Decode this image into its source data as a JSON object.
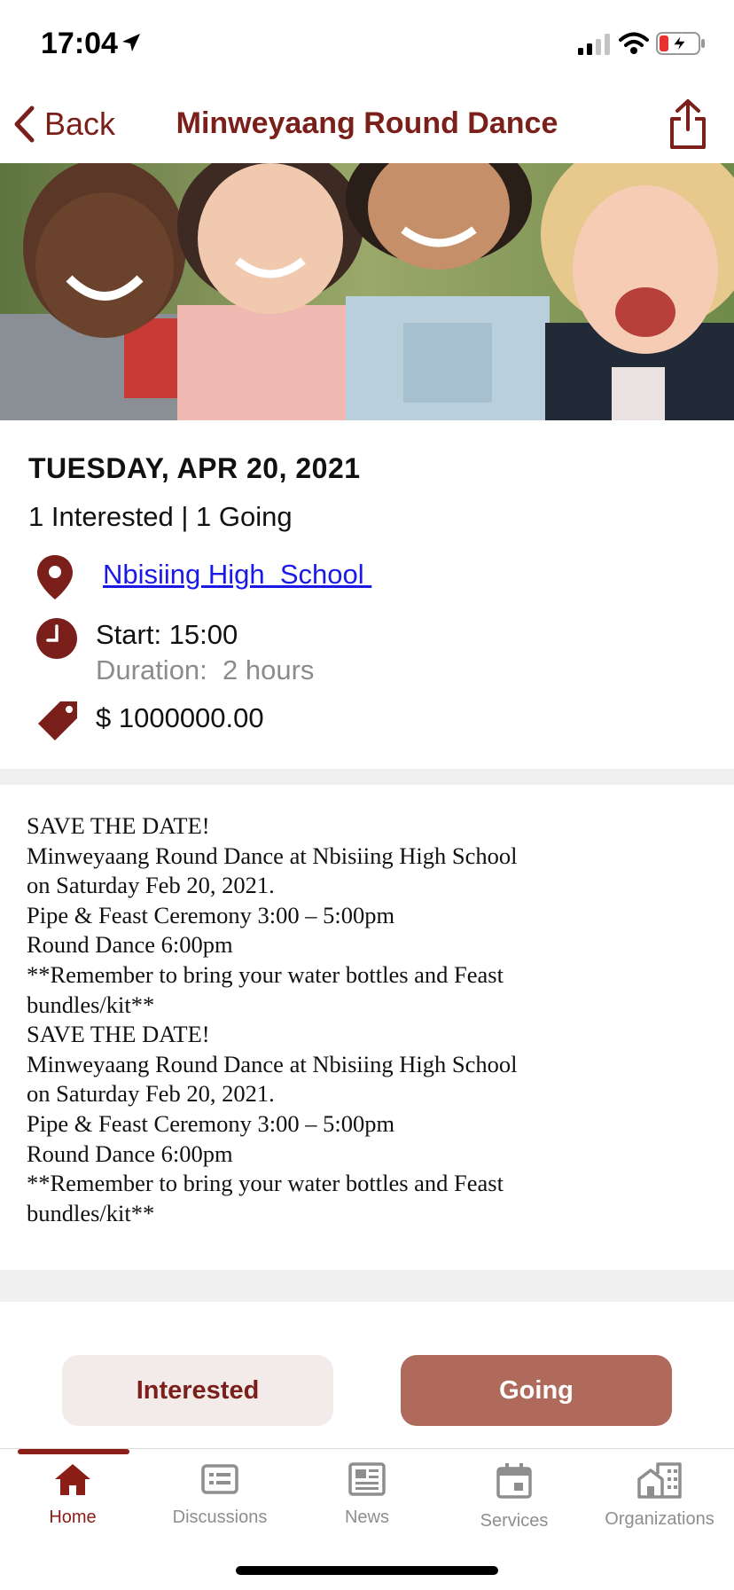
{
  "status": {
    "time": "17:04"
  },
  "nav": {
    "back_label": "Back",
    "title": "Minweyaang Round Dance"
  },
  "event": {
    "date": "TUESDAY, APR 20, 2021",
    "counts": "1 Interested | 1 Going",
    "location": "Nbisiing High  School ",
    "start": "Start: 15:00",
    "duration": "Duration:  2 hours",
    "price": "$ 1000000.00",
    "description": "SAVE THE DATE!\nMinweyaang Round Dance at Nbisiing High School on Saturday Feb 20, 2021.\nPipe & Feast Ceremony 3:00 – 5:00pm\nRound Dance 6:00pm\n**Remember to bring your water bottles and Feast bundles/kit**\nSAVE THE DATE!\nMinweyaang Round Dance at Nbisiing High School on Saturday Feb 20, 2021.\nPipe & Feast Ceremony 3:00 – 5:00pm\nRound Dance 6:00pm\n**Remember to bring your water bottles and Feast bundles/kit**"
  },
  "actions": {
    "interested_label": "Interested",
    "going_label": "Going"
  },
  "tabs": [
    {
      "label": "Home",
      "icon": "home-icon"
    },
    {
      "label": "Discussions",
      "icon": "discussions-icon"
    },
    {
      "label": "News",
      "icon": "news-icon"
    },
    {
      "label": "Services",
      "icon": "services-icon"
    },
    {
      "label": "Organizations",
      "icon": "organizations-icon"
    }
  ],
  "colors": {
    "accent": "#7a1f1a",
    "going_button": "#b06a5b",
    "interested_button": "#f3ebe9",
    "link": "#1a1ae6"
  }
}
